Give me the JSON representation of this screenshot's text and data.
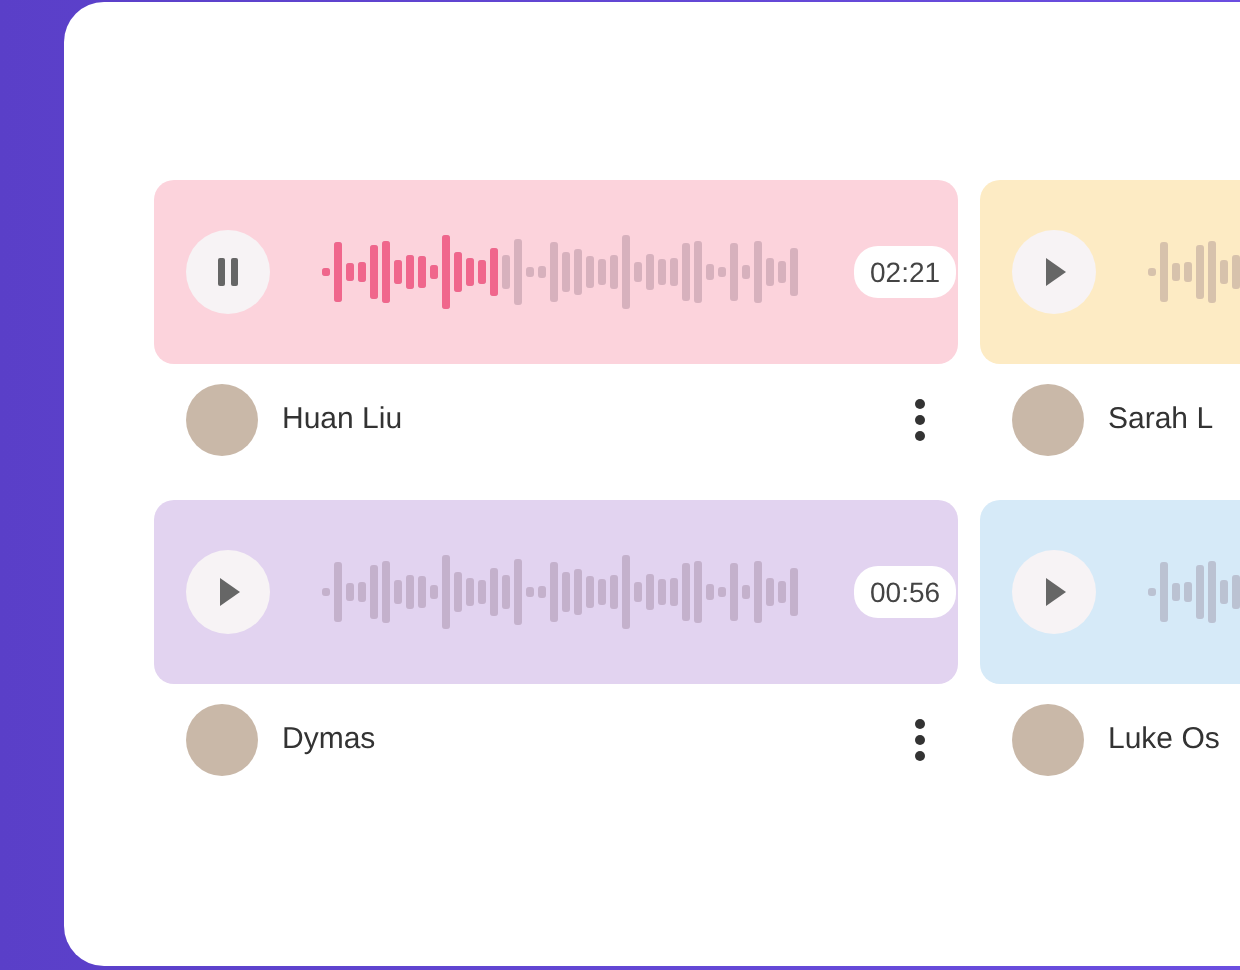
{
  "clips": [
    {
      "name": "Huan Liu",
      "time": "02:21",
      "playing": true,
      "level": 0.38,
      "color": "#fcd3dc"
    },
    {
      "name": "Sarah L",
      "playing": false,
      "color": "#fdebc4"
    },
    {
      "name": "Dymas",
      "time": "00:56",
      "playing": false,
      "color": "#e2d3f0"
    },
    {
      "name": "Luke Os",
      "playing": false,
      "color": "#d6eaf8"
    }
  ]
}
